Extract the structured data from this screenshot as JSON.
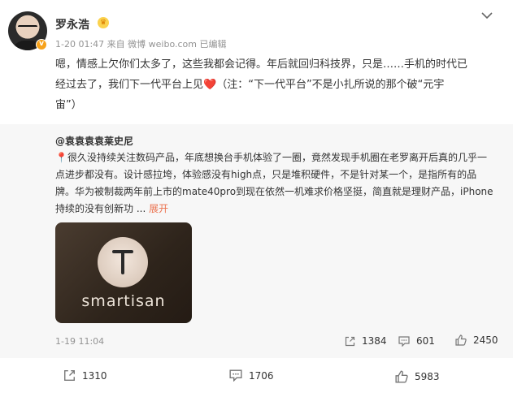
{
  "post": {
    "username": "罗永浩",
    "verified_badge": "v",
    "crown_icon": "vip-crown-icon",
    "meta": "1-20 01:47  来自 微博 weibo.com 已编辑",
    "text_lines": [
      "嗯，情感上欠你们太多了，这些我都会记得。年后就回归科技界，只是……手机的时代已",
      "经过去了，我们下一代平台上见",
      "（注：“下一代平台”不是小扎所说的那个破“元宇",
      "宙”）"
    ],
    "heart_emoji": "❤️"
  },
  "repost": {
    "author": "@袁袁袁袁莱史尼",
    "pin_emoji": "📍",
    "text_lines": [
      "很久没持续关注数码产品，年底想换台手机体验了一圈，竟然发现手机圈在老罗离开后真的几乎一",
      "点进步都没有。设计感拉垮，体验感没有high点，只是堆积硬件，不是针对某一个，是指所有的品",
      "牌。华为被制裁两年前上市的mate40pro到现在依然一机难求价格坚挺，简直就是理财产品，iPhone",
      "持续的没有创新功"
    ],
    "ellipsis": " ... ",
    "expand_label": "展开",
    "image_brand": "smartisan",
    "time": "1-19 11:04",
    "shares": "1384",
    "comments": "601",
    "likes": "2450"
  },
  "actions": {
    "shares": "1310",
    "comments": "1706",
    "likes": "5983"
  }
}
